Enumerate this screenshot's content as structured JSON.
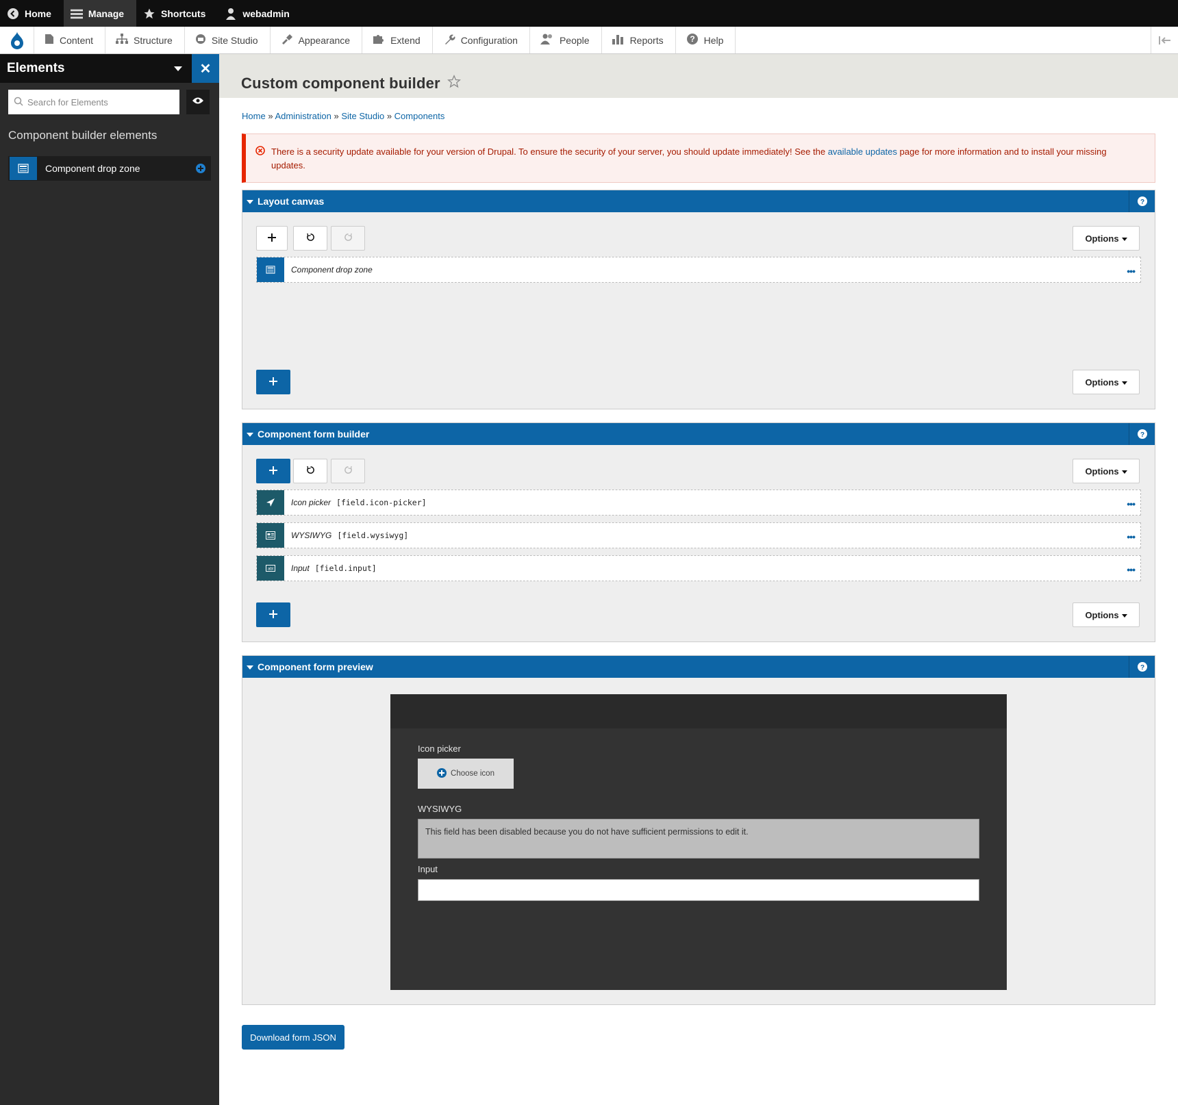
{
  "toolbar": {
    "home": "Home",
    "manage": "Manage",
    "shortcuts": "Shortcuts",
    "user": "webadmin"
  },
  "tray": {
    "items": [
      "Content",
      "Structure",
      "Site Studio",
      "Appearance",
      "Extend",
      "Configuration",
      "People",
      "Reports",
      "Help"
    ]
  },
  "sidebar": {
    "title": "Elements",
    "search_placeholder": "Search for Elements",
    "section": "Component builder elements",
    "element": "Component drop zone"
  },
  "page": {
    "title": "Custom component builder",
    "breadcrumb": [
      "Home",
      "Administration",
      "Site Studio",
      "Components"
    ],
    "breadcrumb_sep": "»"
  },
  "alert": {
    "text_before": "There is a security update available for your version of Drupal. To ensure the security of your server, you should update immediately! See the ",
    "link": "available updates",
    "text_after": " page for more information and to install your missing updates."
  },
  "layout_canvas": {
    "title": "Layout canvas",
    "options_label": "Options",
    "add_label": "+",
    "rows": [
      {
        "label": "Component drop zone",
        "key": ""
      }
    ]
  },
  "form_builder": {
    "title": "Component form builder",
    "options_label": "Options",
    "add_label": "+",
    "rows": [
      {
        "label": "Icon picker",
        "key": "[field.icon-picker]"
      },
      {
        "label": "WYSIWYG",
        "key": "[field.wysiwyg]"
      },
      {
        "label": "Input",
        "key": "[field.input]"
      }
    ]
  },
  "form_preview": {
    "title": "Component form preview",
    "icon_picker_label": "Icon picker",
    "choose_icon": "Choose icon",
    "wysiwyg_label": "WYSIWYG",
    "wysiwyg_disabled": "This field has been disabled because you do not have sufficient permissions to edit it.",
    "input_label": "Input",
    "input_value": ""
  },
  "download_label": "Download form JSON",
  "colors": {
    "accent": "#0d65a6",
    "toolbar_bg": "#0f0f0f",
    "sidebar_bg": "#2b2b2b",
    "alert_border": "#e62600",
    "alert_text": "#a51b00"
  }
}
